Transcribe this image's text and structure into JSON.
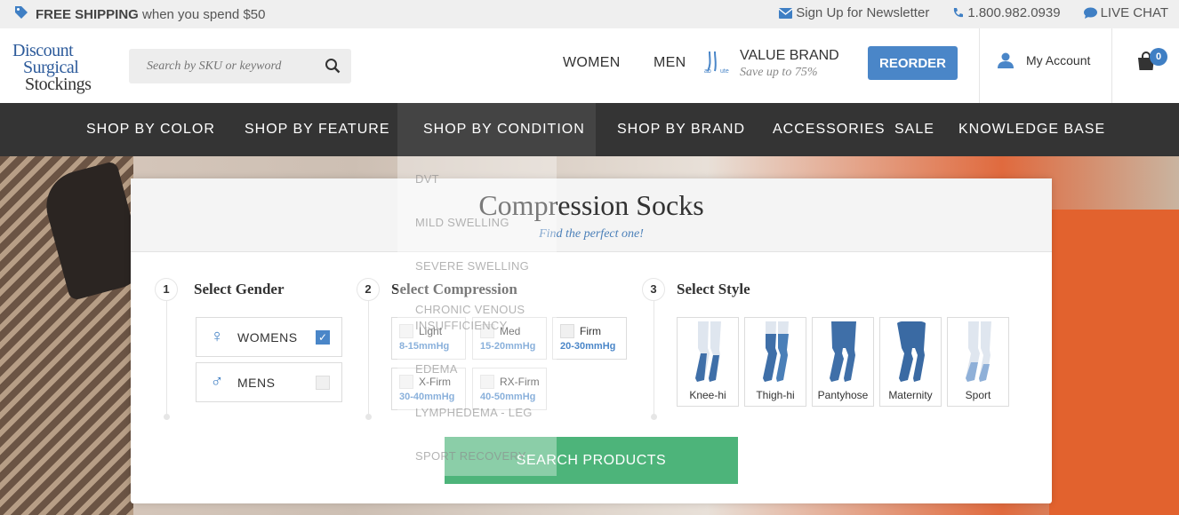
{
  "topbar": {
    "shipping_bold": "FREE SHIPPING",
    "shipping_rest": "when you spend $50",
    "newsletter": "Sign Up for Newsletter",
    "phone": "1.800.982.0939",
    "chat": "LIVE CHAT"
  },
  "header": {
    "logo": [
      "Discount",
      "Surgical",
      "Stockings"
    ],
    "search_placeholder": "Search by SKU or keyword",
    "nav": [
      "WOMEN",
      "MEN"
    ],
    "value_brand_title": "VALUE BRAND",
    "value_brand_sub": "Save up to 75%",
    "reorder": "REORDER",
    "account": "My Account",
    "cart_count": "0"
  },
  "catnav": [
    "SHOP BY COLOR",
    "SHOP BY FEATURE",
    "SHOP BY CONDITION",
    "SHOP BY BRAND",
    "ACCESSORIES",
    "SALE",
    "KNOWLEDGE BASE"
  ],
  "dropdown": [
    "DVT",
    "MILD SWELLING",
    "SEVERE SWELLING",
    "CHRONIC VENOUS INSUFFICIENCY",
    "EDEMA",
    "LYMPHEDEMA - LEG",
    "SPORT RECOVERY"
  ],
  "finder": {
    "title": "Compression Socks",
    "subtitle": "Find the perfect one!",
    "steps": [
      {
        "num": "1",
        "label": "Select Gender"
      },
      {
        "num": "2",
        "label": "Select Compression"
      },
      {
        "num": "3",
        "label": "Select Style"
      }
    ],
    "genders": [
      {
        "label": "WOMENS",
        "checked": true
      },
      {
        "label": "MENS",
        "checked": false
      }
    ],
    "compression": [
      {
        "name": "Light",
        "range": "8-15mmHg"
      },
      {
        "name": "Med",
        "range": "15-20mmHg"
      },
      {
        "name": "Firm",
        "range": "20-30mmHg"
      },
      {
        "name": "X-Firm",
        "range": "30-40mmHg"
      },
      {
        "name": "RX-Firm",
        "range": "40-50mmHg"
      }
    ],
    "styles": [
      "Knee-hi",
      "Thigh-hi",
      "Pantyhose",
      "Maternity",
      "Sport"
    ],
    "search_button": "SEARCH PRODUCTS"
  },
  "colors": {
    "accent": "#4a86c8",
    "nav_bg": "#343434",
    "search_btn": "#4db47a"
  }
}
